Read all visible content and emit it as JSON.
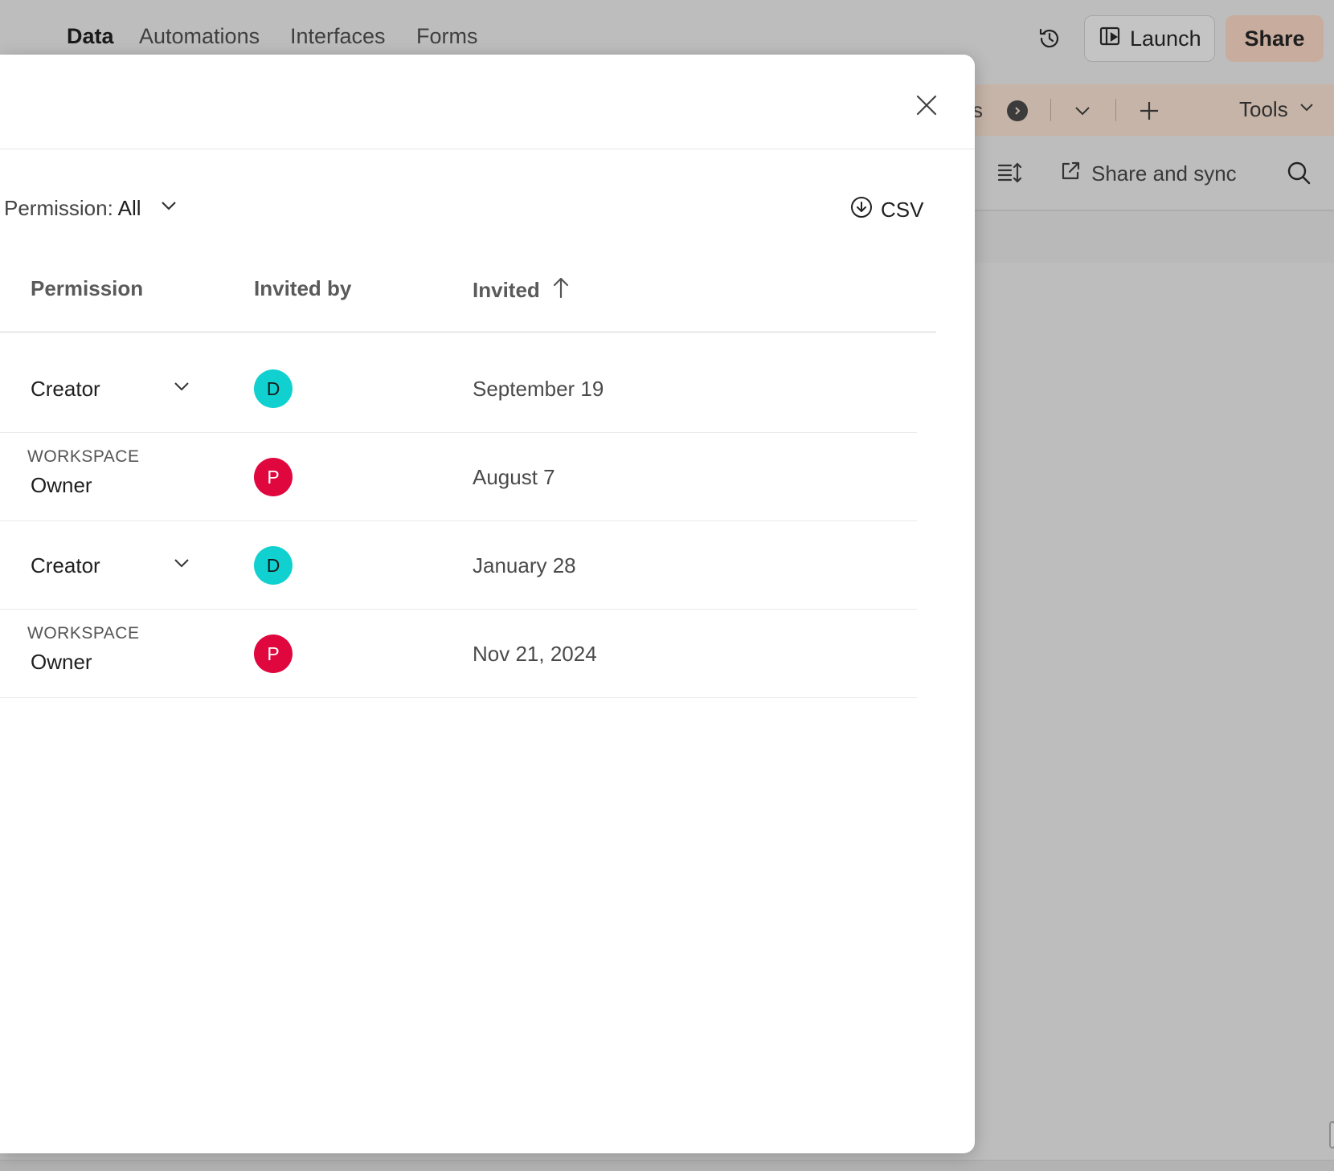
{
  "colors": {
    "avatar_d": "#10d1cf",
    "avatar_p": "#e0073f",
    "share_button": "#c8ad9e"
  },
  "top_nav": {
    "tabs": [
      "Data",
      "Automations",
      "Interfaces",
      "Forms"
    ],
    "active_tab": "Data",
    "history_icon": "history-icon",
    "launch_label": "Launch",
    "share_label": "Share"
  },
  "table_tabs": {
    "partial_tab_text": "s",
    "tools_label": "Tools"
  },
  "view_toolbar": {
    "share_sync_label": "Share and sync"
  },
  "modal": {
    "filter": {
      "label": "Permission:",
      "value": "All"
    },
    "csv_label": "CSV",
    "columns": {
      "permission": "Permission",
      "invited_by": "Invited by",
      "invited": "Invited"
    },
    "rows": [
      {
        "workspace_caption": "",
        "permission": "Creator",
        "has_dropdown": true,
        "invited_by_initial": "D",
        "invited": "September 19"
      },
      {
        "workspace_caption": "WORKSPACE",
        "permission": "Owner",
        "has_dropdown": false,
        "invited_by_initial": "P",
        "invited": "August 7"
      },
      {
        "workspace_caption": "",
        "permission": "Creator",
        "has_dropdown": true,
        "invited_by_initial": "D",
        "invited": "January 28"
      },
      {
        "workspace_caption": "WORKSPACE",
        "permission": "Owner",
        "has_dropdown": false,
        "invited_by_initial": "P",
        "invited": "Nov 21, 2024"
      }
    ]
  }
}
